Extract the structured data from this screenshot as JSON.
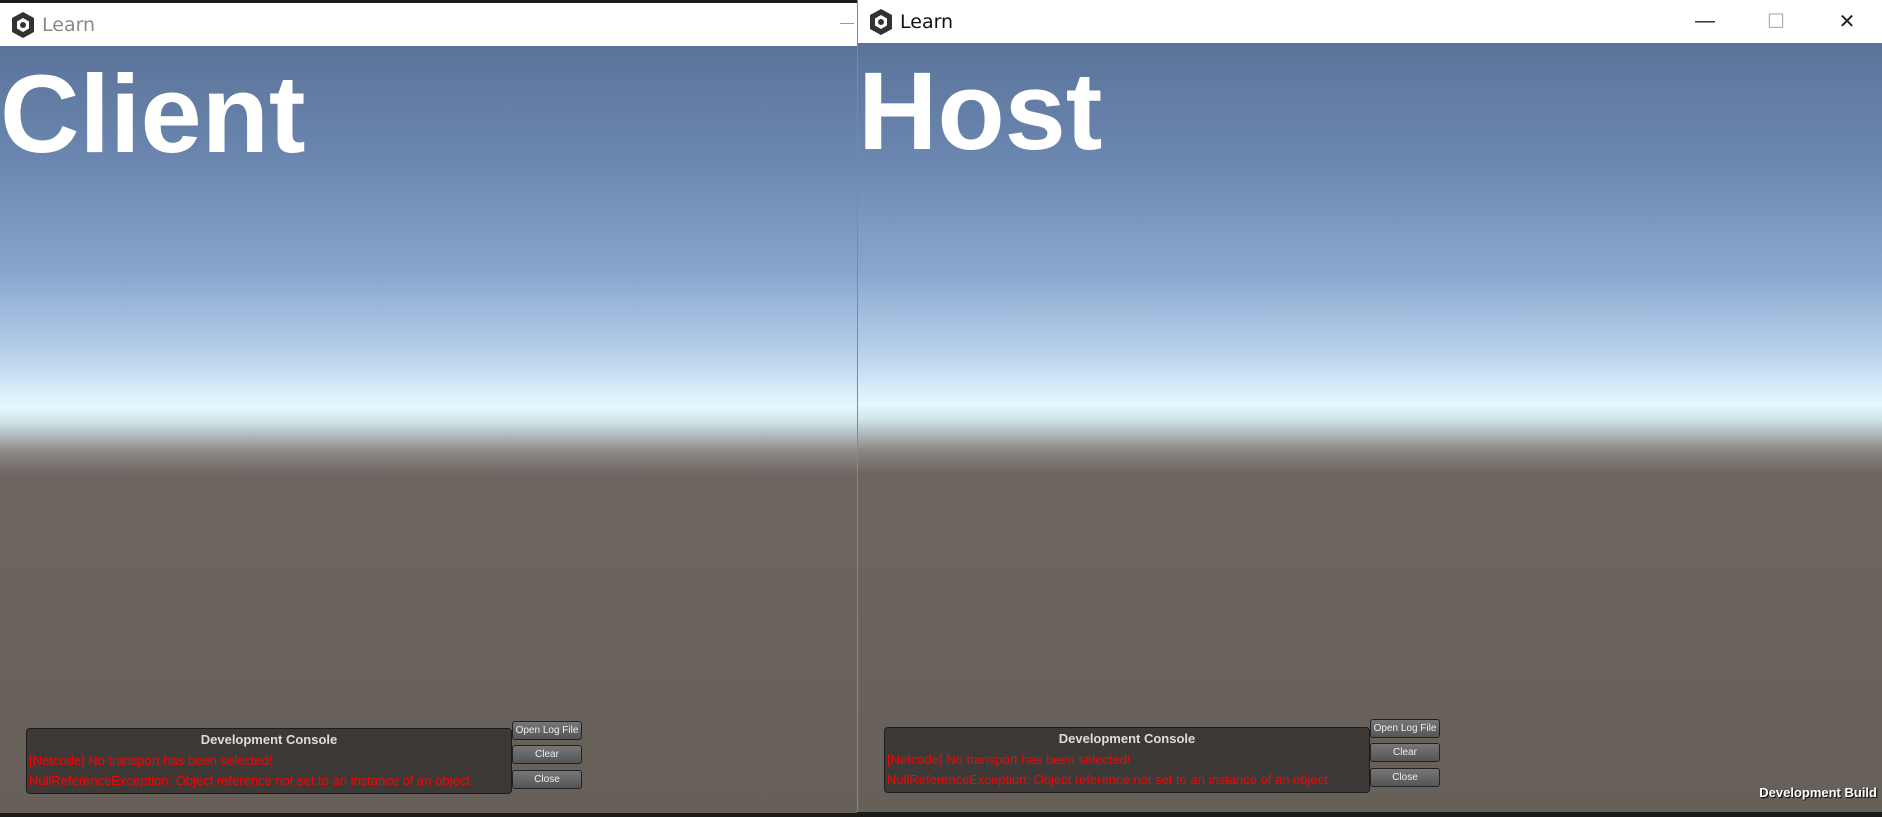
{
  "windows": [
    {
      "title": "Learn",
      "label": "Client",
      "console": {
        "title": "Development Console",
        "lines": [
          "[Netcode] No transport has been selected!",
          "NullReferenceException: Object reference not set to an instance of an object"
        ],
        "buttons": [
          "Open Log File",
          "Clear",
          "Close"
        ]
      }
    },
    {
      "title": "Learn",
      "label": "Host",
      "console": {
        "title": "Development Console",
        "lines": [
          "[Netcode] No transport has been selected!",
          "NullReferenceException: Object reference not set to an instance of an object"
        ],
        "buttons": [
          "Open Log File",
          "Clear",
          "Close"
        ]
      },
      "controls": {
        "minimize": "—",
        "maximize": "☐",
        "close": "✕"
      },
      "watermark": "Development Build"
    }
  ],
  "colors": {
    "error": "#ff0000",
    "console_bg": "#3d3936"
  }
}
